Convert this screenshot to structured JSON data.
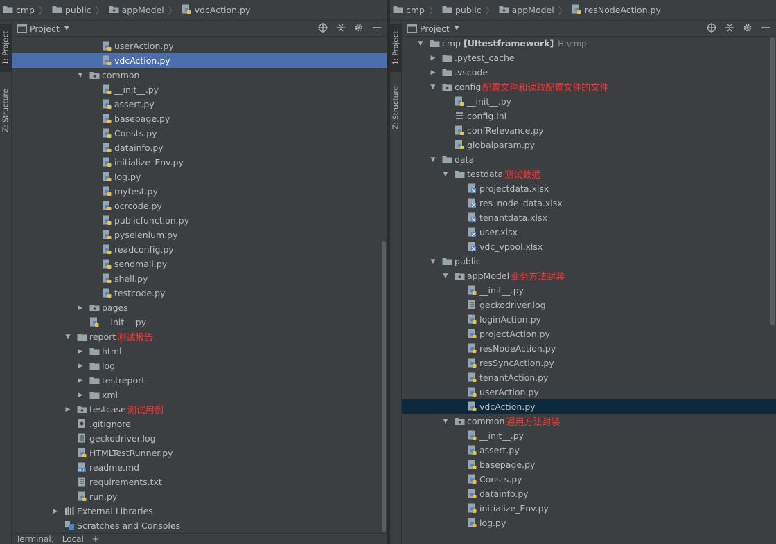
{
  "left": {
    "breadcrumb": [
      "cmp",
      "public",
      "appModel",
      "vdcAction.py"
    ],
    "panel_title": "Project",
    "stripe_tabs": [
      "1: Project",
      "Z: Structure"
    ],
    "bottom": {
      "terminal": "Terminal:",
      "tab": "Local",
      "add": "+"
    },
    "tree": [
      {
        "label": "userAction.py",
        "icon": "python-file-icon",
        "indent": 4
      },
      {
        "label": "vdcAction.py",
        "icon": "python-file-icon",
        "indent": 4,
        "selected": true
      },
      {
        "label": "common",
        "icon": "package-folder-icon",
        "indent": 3,
        "arrow": "open"
      },
      {
        "label": "__init__.py",
        "icon": "python-file-icon",
        "indent": 4
      },
      {
        "label": "assert.py",
        "icon": "python-file-icon",
        "indent": 4
      },
      {
        "label": "basepage.py",
        "icon": "python-file-icon",
        "indent": 4
      },
      {
        "label": "Consts.py",
        "icon": "python-file-icon",
        "indent": 4
      },
      {
        "label": "datainfo.py",
        "icon": "python-file-icon",
        "indent": 4
      },
      {
        "label": "initialize_Env.py",
        "icon": "python-file-icon",
        "indent": 4
      },
      {
        "label": "log.py",
        "icon": "python-file-icon",
        "indent": 4
      },
      {
        "label": "mytest.py",
        "icon": "python-file-icon",
        "indent": 4
      },
      {
        "label": "ocrcode.py",
        "icon": "python-file-icon",
        "indent": 4
      },
      {
        "label": "publicfunction.py",
        "icon": "python-file-icon",
        "indent": 4
      },
      {
        "label": "pyselenium.py",
        "icon": "python-file-icon",
        "indent": 4
      },
      {
        "label": "readconfig.py",
        "icon": "python-file-icon",
        "indent": 4
      },
      {
        "label": "sendmail.py",
        "icon": "python-file-icon",
        "indent": 4
      },
      {
        "label": "shell.py",
        "icon": "python-file-icon",
        "indent": 4
      },
      {
        "label": "testcode.py",
        "icon": "python-file-icon",
        "indent": 4
      },
      {
        "label": "pages",
        "icon": "package-folder-icon",
        "indent": 3,
        "arrow": "closed"
      },
      {
        "label": "__init__.py",
        "icon": "python-file-icon",
        "indent": 3
      },
      {
        "label": "report",
        "icon": "folder-icon",
        "indent": 2,
        "arrow": "open",
        "note": "测试报告"
      },
      {
        "label": "html",
        "icon": "folder-icon",
        "indent": 3,
        "arrow": "closed"
      },
      {
        "label": "log",
        "icon": "folder-icon",
        "indent": 3,
        "arrow": "closed"
      },
      {
        "label": "testreport",
        "icon": "folder-icon",
        "indent": 3,
        "arrow": "closed"
      },
      {
        "label": "xml",
        "icon": "folder-icon",
        "indent": 3,
        "arrow": "closed"
      },
      {
        "label": "testcase",
        "icon": "package-folder-icon",
        "indent": 2,
        "arrow": "closed",
        "note": "测试用例"
      },
      {
        "label": ".gitignore",
        "icon": "gitignore-file-icon",
        "indent": 2
      },
      {
        "label": "geckodriver.log",
        "icon": "text-file-icon",
        "indent": 2
      },
      {
        "label": "HTMLTestRunner.py",
        "icon": "python-file-icon",
        "indent": 2
      },
      {
        "label": "readme.md",
        "icon": "markdown-file-icon",
        "indent": 2
      },
      {
        "label": "requirements.txt",
        "icon": "text-file-icon",
        "indent": 2
      },
      {
        "label": "run.py",
        "icon": "python-file-icon",
        "indent": 2
      },
      {
        "label": "External Libraries",
        "icon": "libraries-icon",
        "indent": 1,
        "arrow": "closed"
      },
      {
        "label": "Scratches and Consoles",
        "icon": "scratches-icon",
        "indent": 1
      }
    ]
  },
  "right": {
    "breadcrumb": [
      "cmp",
      "public",
      "appModel",
      "resNodeAction.py"
    ],
    "panel_title": "Project",
    "stripe_tabs": [
      "1: Project",
      "Z: Structure"
    ],
    "tree": [
      {
        "label": "cmp",
        "bold": "[UItestframework]",
        "dim": "H:\\cmp",
        "icon": "folder-icon",
        "indent": 1,
        "arrow": "open"
      },
      {
        "label": ".pytest_cache",
        "icon": "folder-icon",
        "indent": 2,
        "arrow": "closed"
      },
      {
        "label": ".vscode",
        "icon": "folder-icon",
        "indent": 2,
        "arrow": "closed"
      },
      {
        "label": "config",
        "icon": "package-folder-icon",
        "indent": 2,
        "arrow": "open",
        "note": "配置文件和读取配置文件的文件"
      },
      {
        "label": "__init__.py",
        "icon": "python-file-icon",
        "indent": 3
      },
      {
        "label": "config.ini",
        "icon": "ini-file-icon",
        "indent": 3
      },
      {
        "label": "confRelevance.py",
        "icon": "python-file-icon",
        "indent": 3
      },
      {
        "label": "globalparam.py",
        "icon": "python-file-icon",
        "indent": 3
      },
      {
        "label": "data",
        "icon": "folder-icon",
        "indent": 2,
        "arrow": "open"
      },
      {
        "label": "testdata",
        "icon": "folder-icon",
        "indent": 3,
        "arrow": "open",
        "note": "测试数据"
      },
      {
        "label": "projectdata.xlsx",
        "icon": "excel-file-icon",
        "indent": 4
      },
      {
        "label": "res_node_data.xlsx",
        "icon": "excel-file-icon",
        "indent": 4
      },
      {
        "label": "tenantdata.xlsx",
        "icon": "excel-file-icon",
        "indent": 4
      },
      {
        "label": "user.xlsx",
        "icon": "excel-file-icon",
        "indent": 4
      },
      {
        "label": "vdc_vpool.xlsx",
        "icon": "excel-file-icon",
        "indent": 4
      },
      {
        "label": "public",
        "icon": "folder-icon",
        "indent": 2,
        "arrow": "open"
      },
      {
        "label": "appModel",
        "icon": "package-folder-icon",
        "indent": 3,
        "arrow": "open",
        "note": "业务方法封装"
      },
      {
        "label": "__init__.py",
        "icon": "python-file-icon",
        "indent": 4
      },
      {
        "label": "geckodriver.log",
        "icon": "text-file-icon",
        "indent": 4
      },
      {
        "label": "loginAction.py",
        "icon": "python-file-icon",
        "indent": 4
      },
      {
        "label": "projectAction.py",
        "icon": "python-file-icon",
        "indent": 4
      },
      {
        "label": "resNodeAction.py",
        "icon": "python-file-icon",
        "indent": 4
      },
      {
        "label": "resSyncAction.py",
        "icon": "python-file-icon",
        "indent": 4
      },
      {
        "label": "tenantAction.py",
        "icon": "python-file-icon",
        "indent": 4
      },
      {
        "label": "userAction.py",
        "icon": "python-file-icon",
        "indent": 4
      },
      {
        "label": "vdcAction.py",
        "icon": "python-file-icon",
        "indent": 4,
        "selected": true
      },
      {
        "label": "common",
        "icon": "package-folder-icon",
        "indent": 3,
        "arrow": "open",
        "note": "通用方法封装"
      },
      {
        "label": "__init__.py",
        "icon": "python-file-icon",
        "indent": 4
      },
      {
        "label": "assert.py",
        "icon": "python-file-icon",
        "indent": 4
      },
      {
        "label": "basepage.py",
        "icon": "python-file-icon",
        "indent": 4
      },
      {
        "label": "Consts.py",
        "icon": "python-file-icon",
        "indent": 4
      },
      {
        "label": "datainfo.py",
        "icon": "python-file-icon",
        "indent": 4
      },
      {
        "label": "initialize_Env.py",
        "icon": "python-file-icon",
        "indent": 4
      },
      {
        "label": "log.py",
        "icon": "python-file-icon",
        "indent": 4
      }
    ]
  },
  "toolbar_icons": [
    "locate-icon",
    "collapse-all-icon",
    "settings-gear-icon",
    "hide-icon"
  ]
}
